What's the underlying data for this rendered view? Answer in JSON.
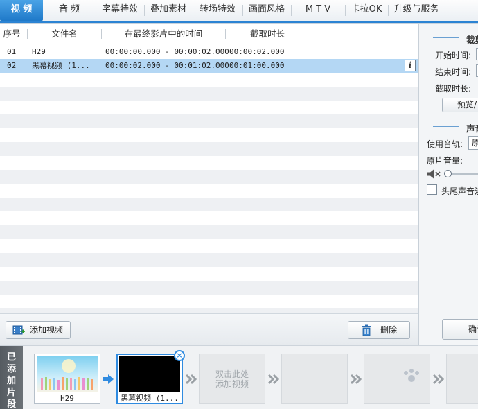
{
  "tabs": [
    {
      "label": "视 频",
      "active": true
    },
    {
      "label": "音 频",
      "active": false
    },
    {
      "label": "字幕特效",
      "active": false
    },
    {
      "label": "叠加素材",
      "active": false
    },
    {
      "label": "转场特效",
      "active": false
    },
    {
      "label": "画面风格",
      "active": false
    },
    {
      "label": "M T V",
      "active": false
    },
    {
      "label": "卡拉OK",
      "active": false
    },
    {
      "label": "升级与服务",
      "active": false
    }
  ],
  "table": {
    "headers": [
      "序号",
      "文件名",
      "在最终影片中的时间",
      "截取时长"
    ],
    "rows": [
      {
        "index": "01",
        "name": "H29",
        "range": "00:00:00.000 - 00:00:02.000",
        "duration": "00:00:02.000",
        "selected": false
      },
      {
        "index": "02",
        "name": "黑幕视频 (1...",
        "range": "00:00:02.000 - 00:01:02.000",
        "duration": "00:01:00.000",
        "selected": true
      }
    ],
    "info_glyph": "i"
  },
  "toolbar": {
    "add_video_label": "添加视频",
    "delete_label": "删除"
  },
  "right_panel": {
    "crop_heading": "裁剪",
    "start_time_label": "开始时间:",
    "end_time_label": "结束时间:",
    "duration_label": "截取时长:",
    "preview_button": "预览/",
    "audio_heading": "声音",
    "track_label": "使用音轨:",
    "track_value": "原",
    "volume_label": "原片音量:",
    "fade_checkbox_label": "头尾声音淡",
    "confirm_button": "确认"
  },
  "timeline": {
    "label_chars": [
      "已",
      "添",
      "加",
      "片",
      "段"
    ],
    "clips": [
      {
        "caption": "H29"
      },
      {
        "caption": "黑幕视频 (1..."
      }
    ],
    "empty_slot_hint_line1": "双击此处",
    "empty_slot_hint_line2": "添加视频"
  },
  "colors": {
    "accent": "#2b83d3",
    "selected_row": "#b4d7f4",
    "alt_row": "#eef0f3"
  }
}
